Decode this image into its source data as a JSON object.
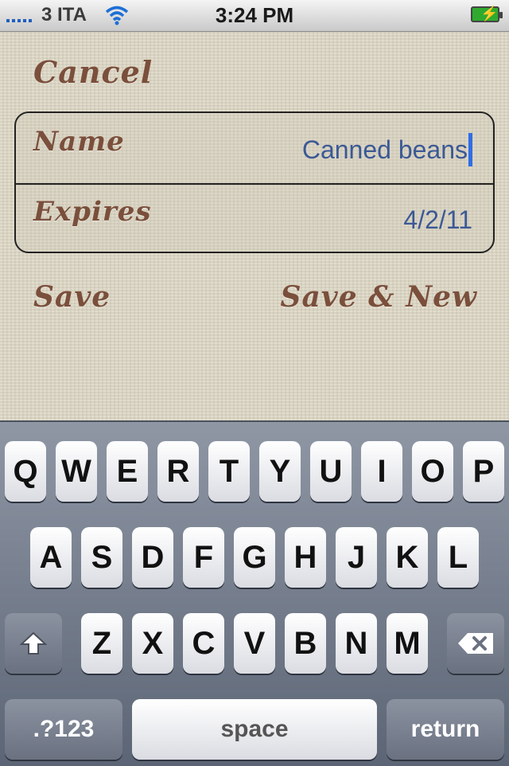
{
  "status_bar": {
    "carrier": "3 ITA",
    "time": "3:24 PM",
    "icons": [
      "signal-icon",
      "wifi-icon",
      "battery-charging-icon"
    ]
  },
  "nav": {
    "cancel_label": "Cancel"
  },
  "form": {
    "name_label": "Name",
    "name_value": "Canned beans",
    "expires_label": "Expires",
    "expires_value": "4/2/11"
  },
  "actions": {
    "save_label": "Save",
    "save_new_label": "Save & New"
  },
  "keyboard": {
    "row1": [
      "Q",
      "W",
      "E",
      "R",
      "T",
      "Y",
      "U",
      "I",
      "O",
      "P"
    ],
    "row2": [
      "A",
      "S",
      "D",
      "F",
      "G",
      "H",
      "J",
      "K",
      "L"
    ],
    "row3": [
      "Z",
      "X",
      "C",
      "V",
      "B",
      "N",
      "M"
    ],
    "numbers_label": ".?123",
    "space_label": "space",
    "return_label": "return",
    "shift_icon": "shift-icon",
    "delete_icon": "backspace-icon"
  },
  "colors": {
    "accent_text": "#3b5995",
    "script_brown": "#7a4f3b",
    "cursor": "#2f6ee6"
  }
}
